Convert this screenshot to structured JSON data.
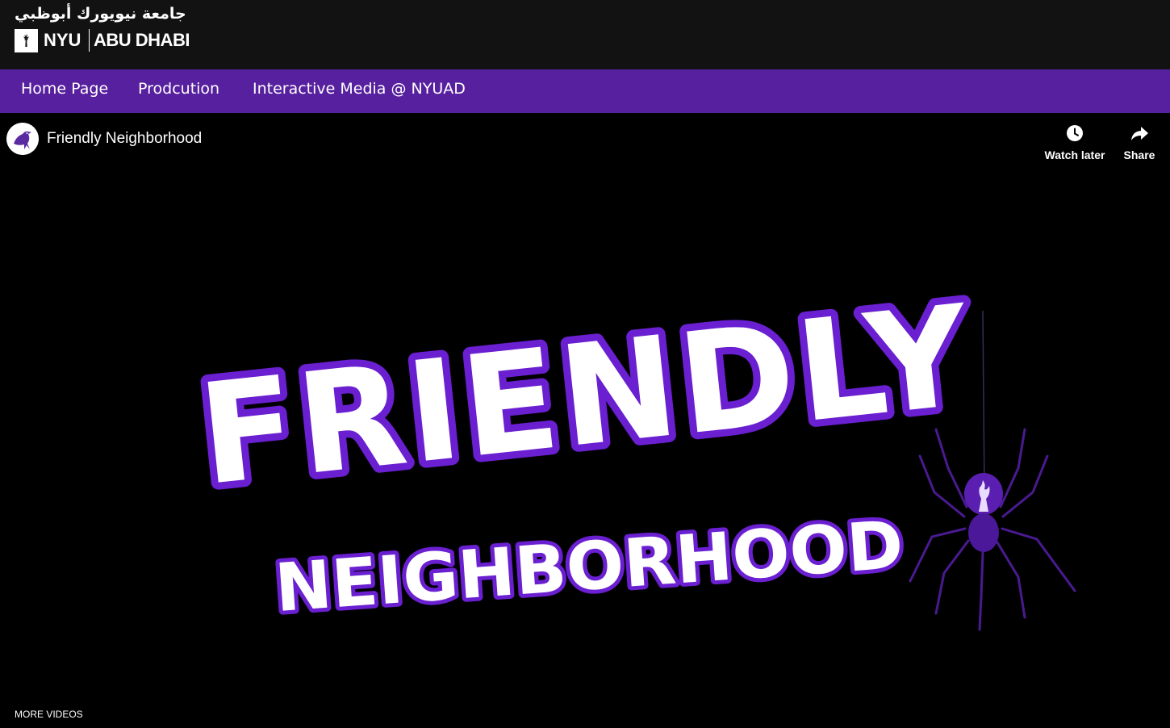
{
  "header": {
    "logo_arabic": "جامعة نيويورك أبوظبي",
    "logo_nyu": "NYU",
    "logo_abu_dhabi": "ABU DHABI"
  },
  "nav": {
    "items": [
      {
        "label": "Home Page"
      },
      {
        "label": "Prodcution"
      },
      {
        "label": "Interactive Media @ NYUAD"
      }
    ]
  },
  "video": {
    "title": "Friendly Neighborhood",
    "watch_later_label": "Watch later",
    "share_label": "Share",
    "more_videos_label": "MORE VIDEOS",
    "thumbnail_text_line1": "FRIENDLY",
    "thumbnail_text_line2": "NEIGHBORHOOD"
  },
  "icons": {
    "logo_mark": "torch-icon",
    "channel_avatar": "raven-icon",
    "watch_later": "clock-icon",
    "share": "share-arrow-icon",
    "thumbnail_spider": "spider-icon"
  },
  "colors": {
    "header_bg": "#121212",
    "nav_bg": "#57209e",
    "accent_purple": "#6a1fd1",
    "video_bg": "#000000",
    "text": "#ffffff"
  }
}
